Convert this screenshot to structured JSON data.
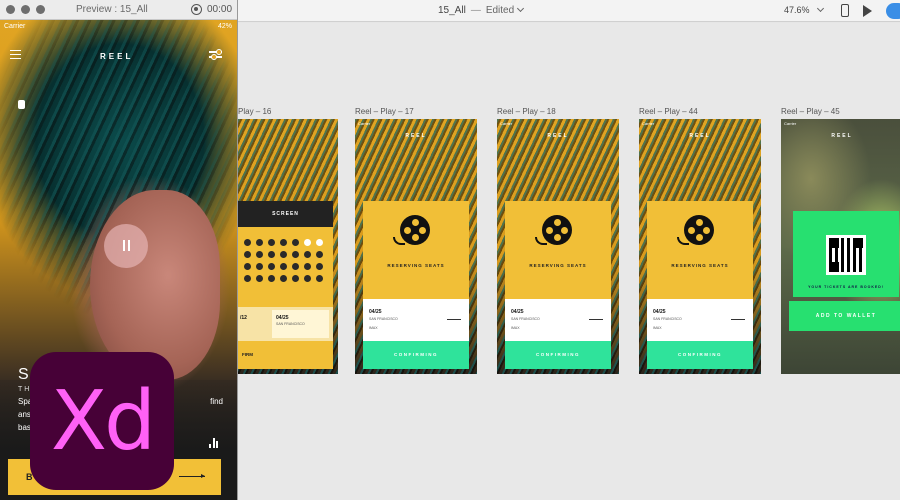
{
  "preview_window": {
    "title": "Preview : 15_All",
    "timer": "00:00"
  },
  "phone": {
    "carrier": "Carrier",
    "battery": "42%",
    "app_title": "REEL",
    "song_title": "SF",
    "song_subtitle": "THR",
    "song_desc_start": "Spa",
    "song_desc_line2": "answ",
    "song_desc_line3": "base",
    "song_desc_end": "find",
    "book_button": "BO"
  },
  "toolbar": {
    "doc_title": "15_All",
    "status": "Edited",
    "zoom": "47.6%"
  },
  "artboards": [
    {
      "label": "Play – 16"
    },
    {
      "label": "Reel – Play – 17",
      "card_title": "RESERVING SEATS",
      "date": "04/25",
      "city": "SAN FRANCISCO",
      "theater": "IMAX",
      "confirm": "CONFIRMING"
    },
    {
      "label": "Reel – Play – 18",
      "card_title": "RESERVING SEATS",
      "date": "04/25",
      "city": "SAN FRANCISCO",
      "theater": "IMAX",
      "confirm": "CONFIRMING"
    },
    {
      "label": "Reel – Play – 44",
      "card_title": "RESERVING SEATS",
      "date": "04/25",
      "city": "SAN FRANCISCO",
      "theater": "IMAX",
      "confirm": "CONFIRMING"
    },
    {
      "label": "Reel – Play – 45",
      "qr_caption": "YOUR TICKETS ARE BOOKED!",
      "wallet_button": "ADD TO WALLET"
    }
  ],
  "artboard16": {
    "screen": "SCREEN",
    "date1": "/12",
    "date2": "04/25",
    "city2": "SAN FRANCISCO",
    "confirm": "FIRM"
  },
  "mini_status": {
    "carrier": "Carrier",
    "reel": "REEL"
  },
  "logo": {
    "text": "Xd"
  }
}
